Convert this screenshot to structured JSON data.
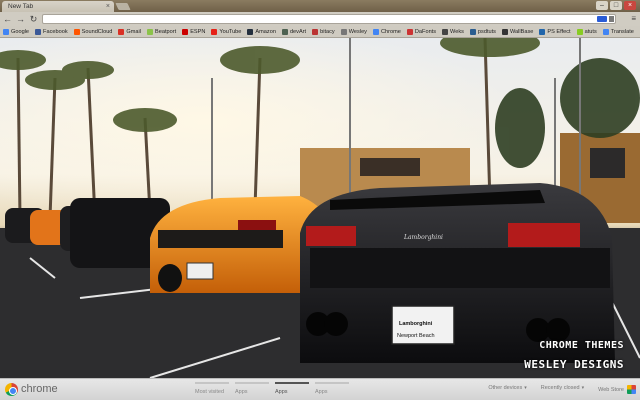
{
  "window": {
    "tab_title": "New Tab",
    "tab_close": "×",
    "controls": {
      "minimize": "–",
      "maximize": "□",
      "close": "×"
    }
  },
  "toolbar": {
    "back": "←",
    "forward": "→",
    "reload": "↻",
    "url_value": "",
    "menu": "≡"
  },
  "bookmarks": [
    {
      "label": "Google",
      "color": "#4285f4"
    },
    {
      "label": "Facebook",
      "color": "#3b5998"
    },
    {
      "label": "SoundCloud",
      "color": "#ff5500"
    },
    {
      "label": "Gmail",
      "color": "#d93025"
    },
    {
      "label": "Beatport",
      "color": "#8bc34a"
    },
    {
      "label": "ESPN",
      "color": "#cc0000"
    },
    {
      "label": "YouTube",
      "color": "#e62117"
    },
    {
      "label": "Amazon",
      "color": "#232f3e"
    },
    {
      "label": "devArt",
      "color": "#4e6252"
    },
    {
      "label": "bitacy",
      "color": "#b33"
    },
    {
      "label": "Wesley",
      "color": "#777"
    },
    {
      "label": "Chrome",
      "color": "#4285f4"
    },
    {
      "label": "DaFonts",
      "color": "#c33"
    },
    {
      "label": "Weks",
      "color": "#444"
    },
    {
      "label": "psdtuts",
      "color": "#2b5d8f"
    },
    {
      "label": "WallBase",
      "color": "#333"
    },
    {
      "label": "PS Effect",
      "color": "#26a"
    },
    {
      "label": "atuts",
      "color": "#8c2"
    },
    {
      "label": "Translate",
      "color": "#4285f4"
    }
  ],
  "scene": {
    "line1": "CHROME THEMES",
    "line2": "WESLEY DESIGNS",
    "plate_brand": "Lamborghini",
    "plate_city": "Newport Beach",
    "car_script": "Lamborghini"
  },
  "ntp": {
    "brand": "chrome",
    "pages": [
      "Most visited",
      "Apps",
      "Apps",
      "Apps"
    ],
    "active_page": 2,
    "other_devices": "Other devices",
    "recently_closed": "Recently closed",
    "web_store": "Web Store"
  }
}
